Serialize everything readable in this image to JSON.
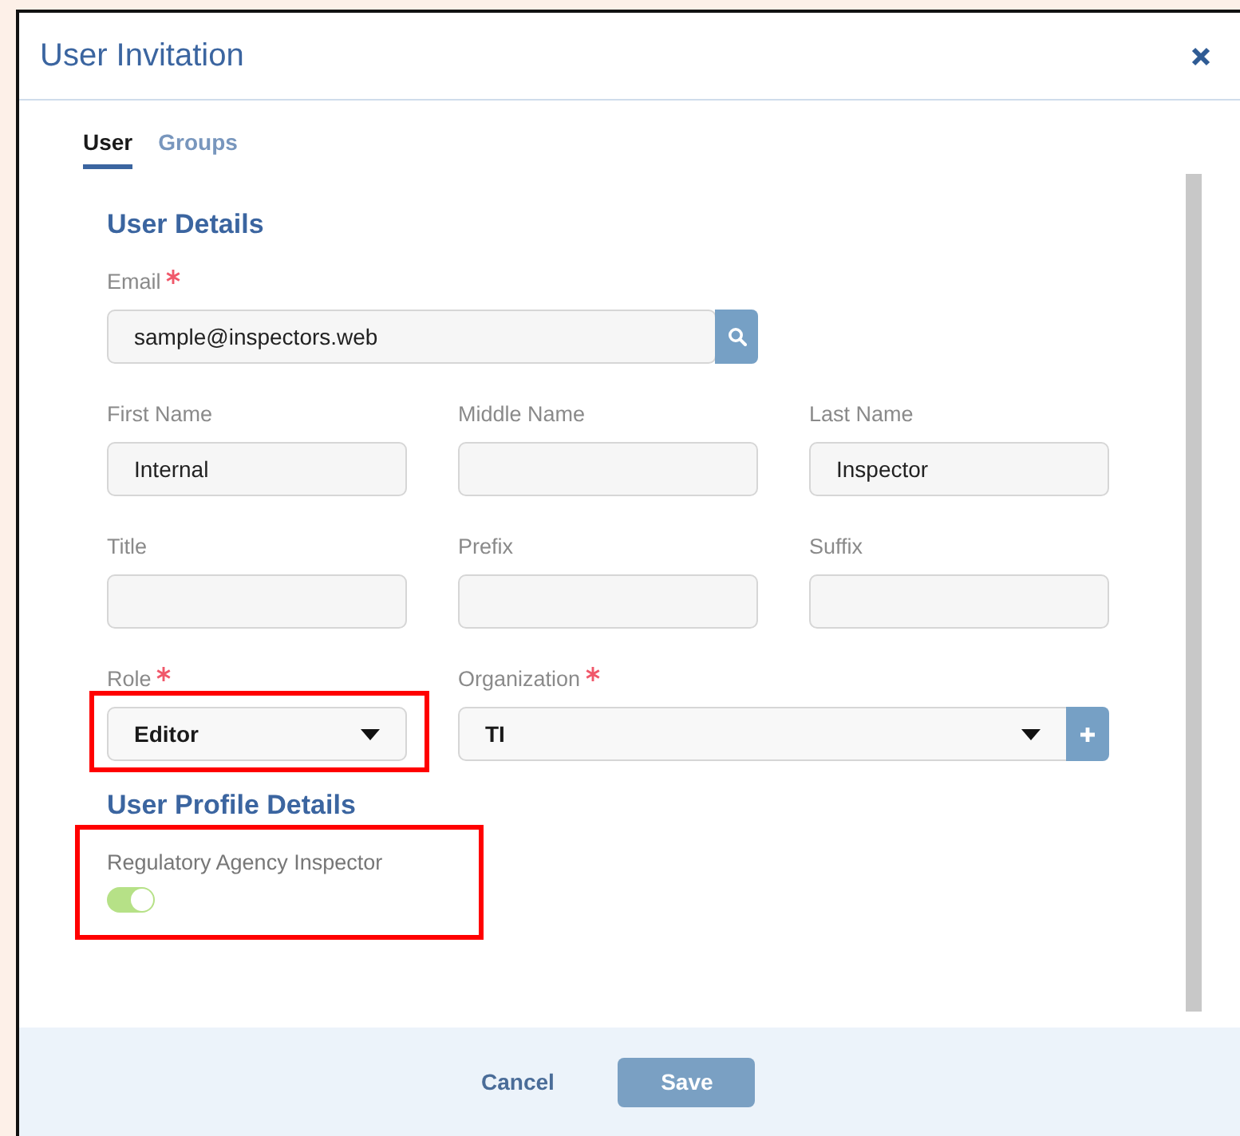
{
  "dialog": {
    "title": "User Invitation"
  },
  "tabs": [
    {
      "label": "User",
      "selected": true
    },
    {
      "label": "Groups",
      "selected": false
    }
  ],
  "sections": [
    {
      "heading": "User Details",
      "rows": [
        [
          {
            "kind": "email",
            "label": "Email",
            "required": true,
            "value": "sample@inspectors.web",
            "highlighted": false
          }
        ],
        [
          {
            "kind": "text",
            "label": "First Name",
            "required": false,
            "value": "Internal",
            "highlighted": false
          },
          {
            "kind": "text",
            "label": "Middle Name",
            "required": false,
            "highlighted": false
          },
          {
            "kind": "text",
            "label": "Last Name",
            "required": false,
            "value": "Inspector",
            "highlighted": false
          }
        ],
        [
          {
            "kind": "text",
            "label": "Title",
            "required": false,
            "highlighted": false
          },
          {
            "kind": "text",
            "label": "Prefix",
            "required": false,
            "highlighted": false
          },
          {
            "kind": "text",
            "label": "Suffix",
            "required": false,
            "highlighted": false
          }
        ],
        [
          {
            "kind": "select",
            "label": "Role",
            "required": true,
            "value": "Editor",
            "highlighted": true
          },
          {
            "kind": "select_add",
            "label": "Organization",
            "required": true,
            "value": "TI",
            "highlighted": false
          }
        ]
      ]
    },
    {
      "heading": "User Profile Details",
      "rows": [
        [
          {
            "kind": "toggle",
            "label": "Regulatory Agency Inspector",
            "required": false,
            "on": true,
            "highlighted": true
          }
        ]
      ]
    }
  ],
  "footer": [
    {
      "kind": "link",
      "label": "Cancel"
    },
    {
      "kind": "primary",
      "label": "Save"
    }
  ]
}
